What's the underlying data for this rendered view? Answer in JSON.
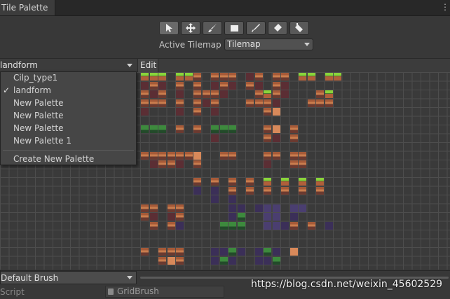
{
  "window": {
    "tab_title": "Tile Palette"
  },
  "toolbar": {
    "tools": [
      {
        "icon": "select-icon",
        "active": true
      },
      {
        "icon": "move-icon"
      },
      {
        "icon": "paint-brush-icon"
      },
      {
        "icon": "box-fill-icon"
      },
      {
        "icon": "picker-icon"
      },
      {
        "icon": "eraser-icon"
      },
      {
        "icon": "fill-bucket-icon"
      }
    ],
    "active_tilemap_label": "Active Tilemap",
    "active_tilemap_value": "Tilemap"
  },
  "palette": {
    "selected": "landform",
    "edit_label": "Edit",
    "options": [
      "Cilp_type1",
      "landform",
      "New Palette",
      "New Palette",
      "New Palette",
      "New Palette 1"
    ],
    "checked_index": 1,
    "create_label": "Create New Palette"
  },
  "brush": {
    "selected": "Default Brush",
    "script_label": "Script",
    "script_value": "GridBrush"
  },
  "watermark": "https://blog.csdn.net/weixin_45602529"
}
